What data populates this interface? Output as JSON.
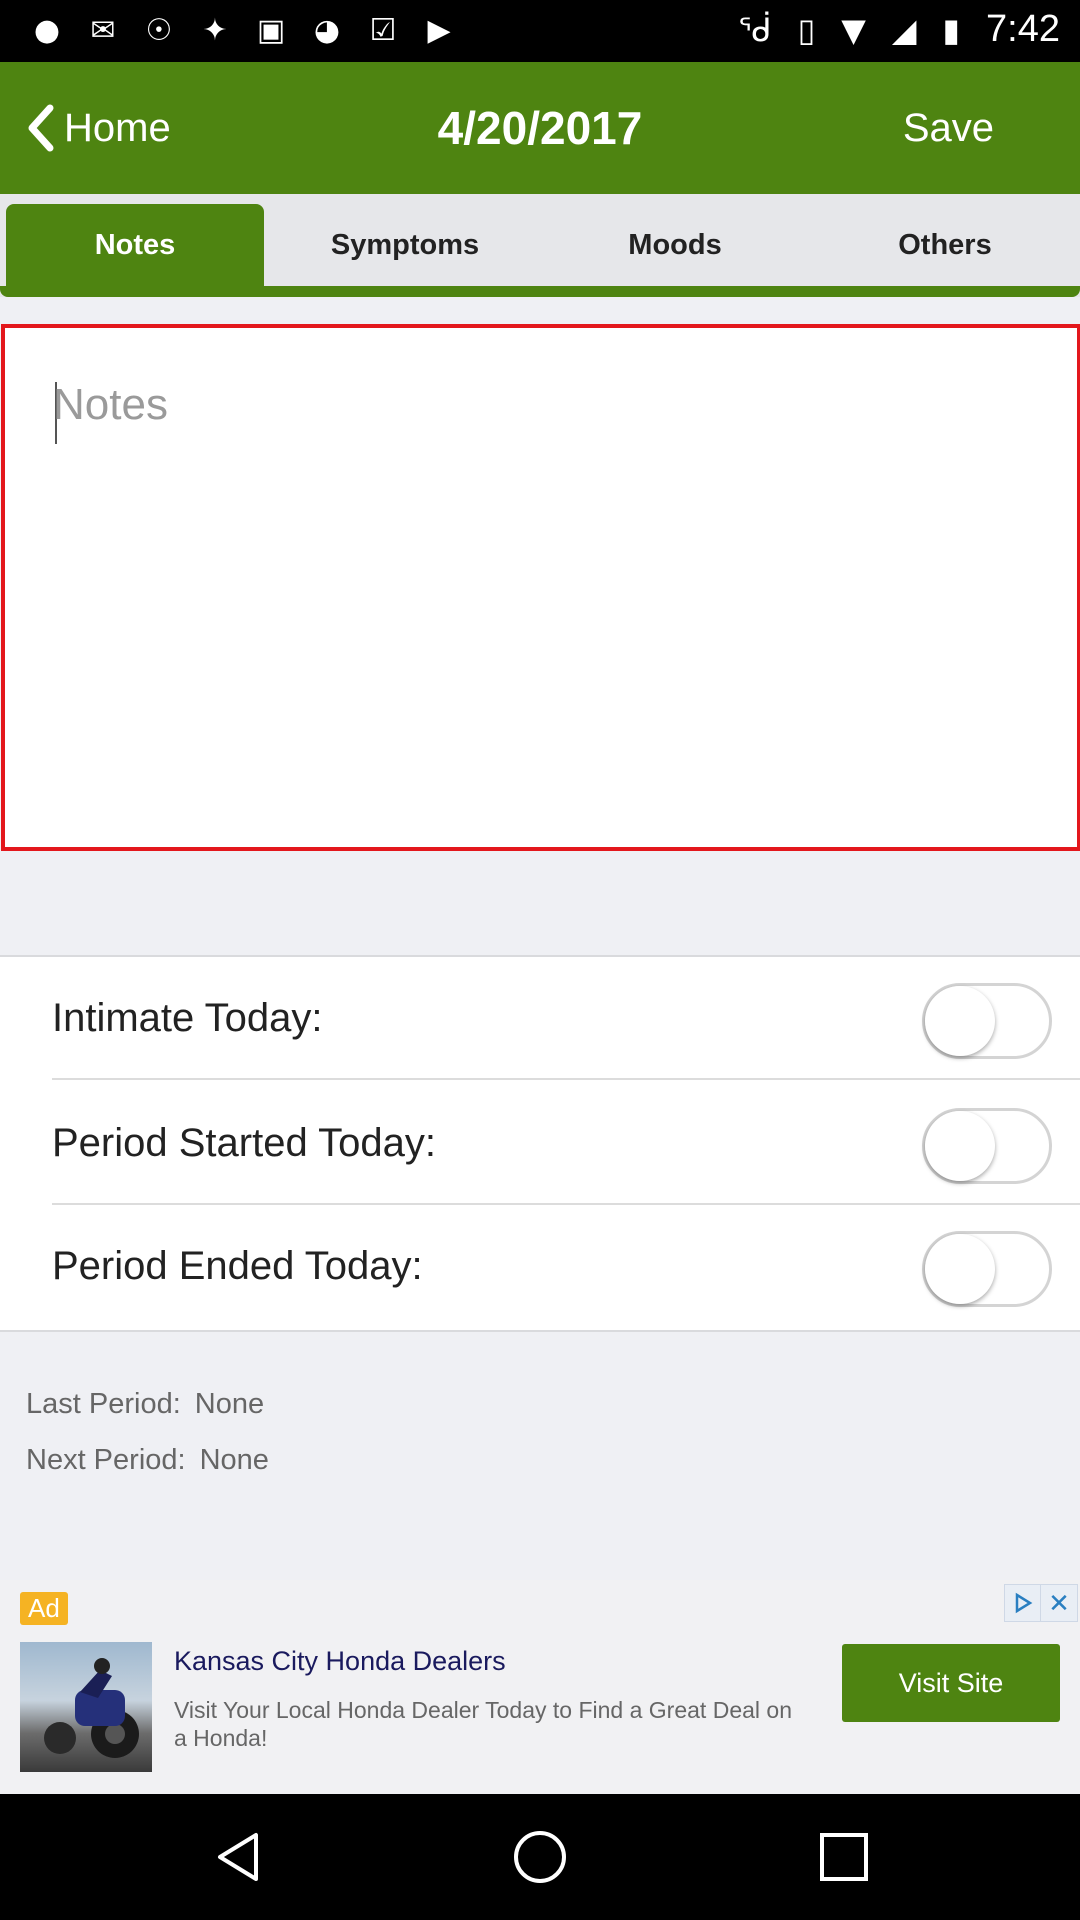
{
  "status_bar": {
    "time": "7:42",
    "left_icons": [
      "location-icon",
      "mail-icon",
      "sync-icon",
      "fake-gps-icon",
      "lock-icon",
      "android-icon",
      "clipboard-check-icon",
      "play-store-icon"
    ],
    "right_icons": [
      "bluetooth-icon",
      "vibrate-icon",
      "wifi-icon",
      "cell-signal-icon",
      "battery-icon"
    ]
  },
  "header": {
    "back_label": "Home",
    "date": "4/20/2017",
    "save_label": "Save",
    "color": "#4e8411"
  },
  "tabs": [
    {
      "label": "Notes",
      "active": true
    },
    {
      "label": "Symptoms",
      "active": false
    },
    {
      "label": "Moods",
      "active": false
    },
    {
      "label": "Others",
      "active": false
    }
  ],
  "notes": {
    "placeholder": "Notes",
    "value": "",
    "border_color": "#e3171c"
  },
  "toggles": [
    {
      "label": "Intimate Today:",
      "on": false
    },
    {
      "label": "Period Started Today:",
      "on": false
    },
    {
      "label": "Period Ended Today:",
      "on": false
    }
  ],
  "period_info": {
    "last_label": "Last Period:",
    "last_value": "None",
    "next_label": "Next Period:",
    "next_value": "None"
  },
  "ad": {
    "badge": "Ad",
    "headline": "Kansas City Honda Dealers",
    "description": "Visit Your Local Honda Dealer Today to Find a Great Deal on a Honda!",
    "cta": "Visit Site"
  },
  "nav": [
    "back-icon",
    "home-icon",
    "recents-icon"
  ]
}
